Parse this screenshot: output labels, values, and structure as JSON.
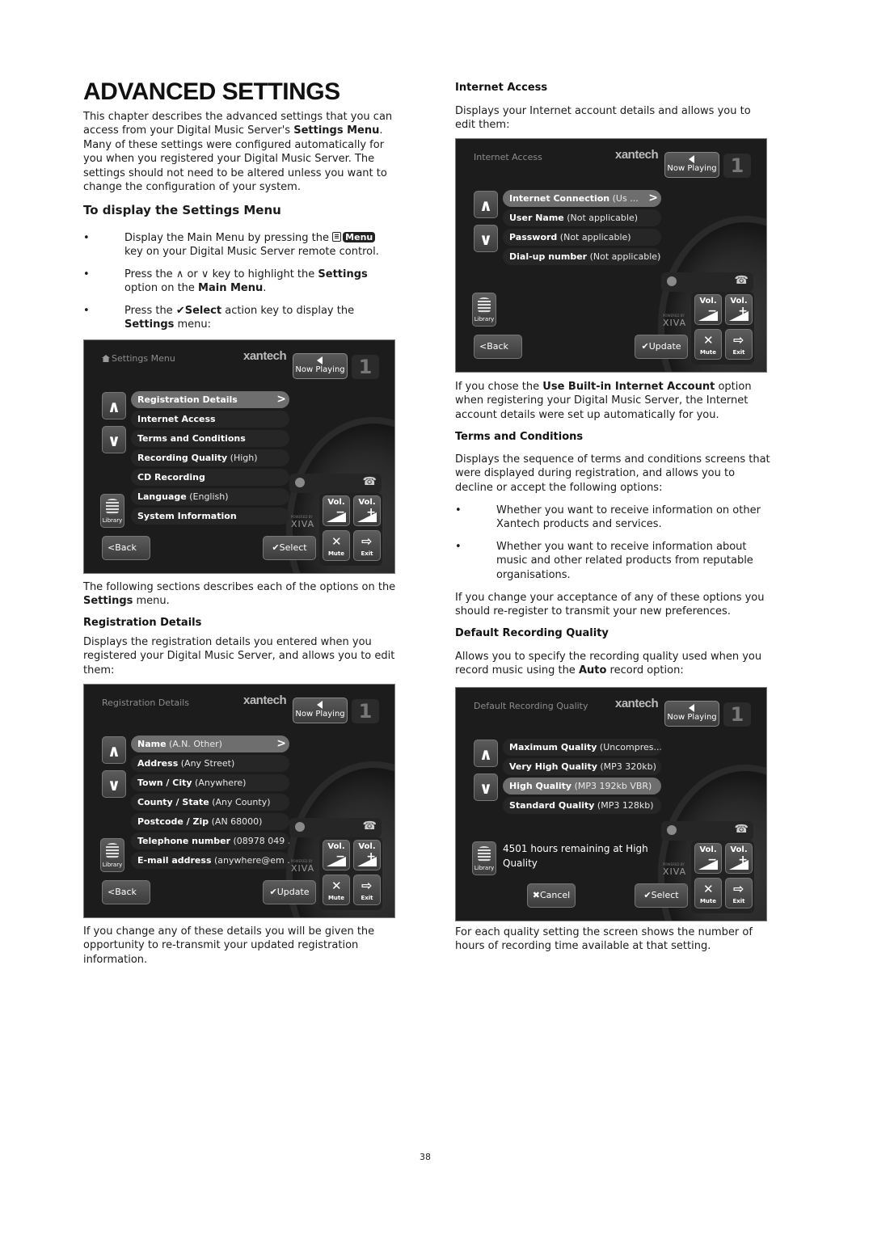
{
  "heading": "ADVANCED SETTINGS",
  "intro": {
    "p1": "This chapter describes the advanced settings that you can access from your Digital Music Server's ",
    "p1_bold": "Settings Menu",
    "p1_end": ". Many of these settings were configured automatically for you when you registered your Digital Music Server. The settings should not need to be altered unless you want to change the configuration of your system."
  },
  "display_section": {
    "title": "To display the Settings Menu",
    "bullets": [
      {
        "pre": "Display the Main Menu by pressing the ",
        "key": "Menu",
        "post": " key on your Digital Music Server remote control."
      },
      {
        "pre": "Press the ",
        "up": "∧",
        "mid": " or ",
        "down": "∨",
        "mid2": " key to highlight the ",
        "b1": "Settings",
        "mid3": " option on the ",
        "b2": "Main Menu",
        "post": "."
      },
      {
        "pre": "Press the ",
        "b1": "✔Select",
        "mid": " action key to display the ",
        "b2": "Settings",
        "post": " menu:"
      }
    ],
    "bullet_char": "•"
  },
  "common_screen": {
    "logo": "xantech",
    "now_playing": "Now Playing",
    "zone": "1",
    "library": "Library",
    "back": "Back",
    "vol_label": "Vol.",
    "vol_minus": "−",
    "vol_plus": "+",
    "mute": "Mute",
    "exit": "Exit",
    "powered_by": "POWERED BY",
    "xiva": "XIVA",
    "phone_icon": "☎"
  },
  "screens": {
    "settings": {
      "title": "Settings Menu",
      "items": [
        {
          "k": "Registration Details",
          "v": ""
        },
        {
          "k": "Internet Access",
          "v": ""
        },
        {
          "k": "Terms and Conditions",
          "v": ""
        },
        {
          "k": "Recording Quality",
          "v": " (High)"
        },
        {
          "k": "CD Recording",
          "v": ""
        },
        {
          "k": "Language",
          "v": " (English)"
        },
        {
          "k": "System Information",
          "v": ""
        }
      ],
      "action": "Select"
    },
    "registration": {
      "title": "Registration Details",
      "items": [
        {
          "k": "Name",
          "v": " (A.N. Other)"
        },
        {
          "k": "Address",
          "v": " (Any Street)"
        },
        {
          "k": "Town / City",
          "v": " (Anywhere)"
        },
        {
          "k": "County / State",
          "v": " (Any County)"
        },
        {
          "k": "Postcode / Zip",
          "v": " (AN 68000)"
        },
        {
          "k": "Telephone number",
          "v": " (08978 049 ..."
        },
        {
          "k": "E-mail address",
          "v": " (anywhere@em ..."
        }
      ],
      "action": "Update"
    },
    "internet": {
      "title": "Internet Access",
      "items": [
        {
          "k": "Internet Connection",
          "v": " (Us ..."
        },
        {
          "k": "User Name",
          "v": " (Not applicable)"
        },
        {
          "k": "Password",
          "v": " (Not applicable)"
        },
        {
          "k": "Dial-up number",
          "v": " (Not applicable)"
        }
      ],
      "action": "Update"
    },
    "quality": {
      "title": "Default Recording Quality",
      "items": [
        {
          "k": "Maximum Quality",
          "v": " (Uncompres..."
        },
        {
          "k": "Very High Quality",
          "v": " (MP3 320kb)"
        },
        {
          "k": "High Quality",
          "v": " (MP3 192kb VBR)"
        },
        {
          "k": "Standard Quality",
          "v": " (MP3 128kb)"
        }
      ],
      "hours": "4501 hours remaining at High Quality",
      "cancel": "Cancel",
      "action": "Select"
    }
  },
  "after_settings": {
    "p_pre": "The following sections describes each of the options on the ",
    "p_bold": "Settings",
    "p_post": " menu."
  },
  "registration_section": {
    "title": "Registration Details",
    "body": "Displays the registration details you entered when you registered your Digital Music Server, and allows you to edit them:",
    "after": "If you change any of these details you will be given the opportunity to re-transmit your updated registration information."
  },
  "internet_section": {
    "title": "Internet Access",
    "body": "Displays your Internet account details and allows you to edit them:",
    "after_pre": "If you chose the ",
    "after_bold": "Use Built-in Internet Account",
    "after_post": " option when registering your Digital Music Server, the Internet account details were set up automatically for you."
  },
  "terms_section": {
    "title": "Terms and Conditions",
    "body": "Displays the sequence of terms and conditions screens that were displayed during registration, and allows you to decline or accept the following options:",
    "bullets": [
      "Whether you want to receive information on other Xantech products and services.",
      "Whether you want to receive information about music and other related products from reputable organisations."
    ],
    "after": "If you change your acceptance of any of these options you should re-register to transmit your new preferences."
  },
  "quality_section": {
    "title": "Default Recording Quality",
    "body_pre": "Allows you to specify the recording quality used when you record music using the ",
    "body_bold": "Auto",
    "body_post": " record option:",
    "after": "For each quality setting the screen shows the number of hours of recording time available at that setting."
  },
  "page_number": "38"
}
